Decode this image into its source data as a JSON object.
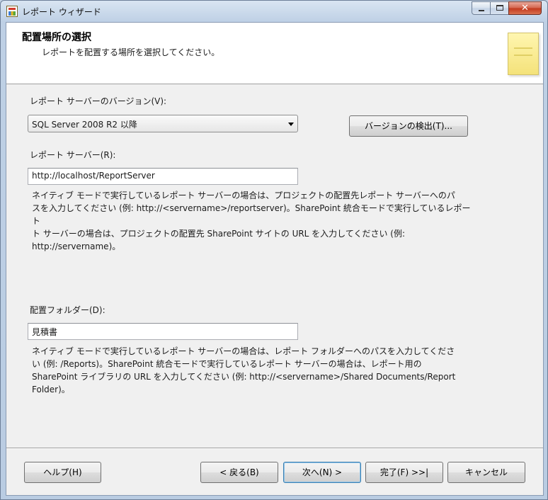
{
  "window": {
    "title": "レポート ウィザード"
  },
  "header": {
    "title": "配置場所の選択",
    "subtitle": "レポートを配置する場所を選択してください。"
  },
  "version": {
    "label": "レポート サーバーのバージョン(V):",
    "selected": "SQL Server 2008 R2 以降",
    "detect_button": "バージョンの検出(T)..."
  },
  "server": {
    "label": "レポート サーバー(R):",
    "value": "http://localhost/ReportServer",
    "help": [
      "ネイティブ モードで実行しているレポート サーバーの場合は、プロジェクトの配置先レポート サーバーへのパ",
      "スを入力してください (例: http://<servername>/reportserver)。SharePoint 統合モードで実行しているレポート",
      "ト サーバーの場合は、プロジェクトの配置先 SharePoint サイトの URL を入力してください (例:",
      "http://servername)。"
    ]
  },
  "folder": {
    "label": "配置フォルダー(D):",
    "value": "見積書",
    "help": [
      "ネイティブ モードで実行しているレポート サーバーの場合は、レポート フォルダーへのパスを入力してくださ",
      "い (例: /Reports)。SharePoint 統合モードで実行しているレポート サーバーの場合は、レポート用の",
      "SharePoint ライブラリの URL を入力してください (例: http://<servername>/Shared Documents/Report",
      "Folder)。"
    ]
  },
  "buttons": {
    "help": "ヘルプ(H)",
    "back": "< 戻る(B)",
    "next": "次へ(N) >",
    "finish": "完了(F) >>|",
    "cancel": "キャンセル"
  }
}
